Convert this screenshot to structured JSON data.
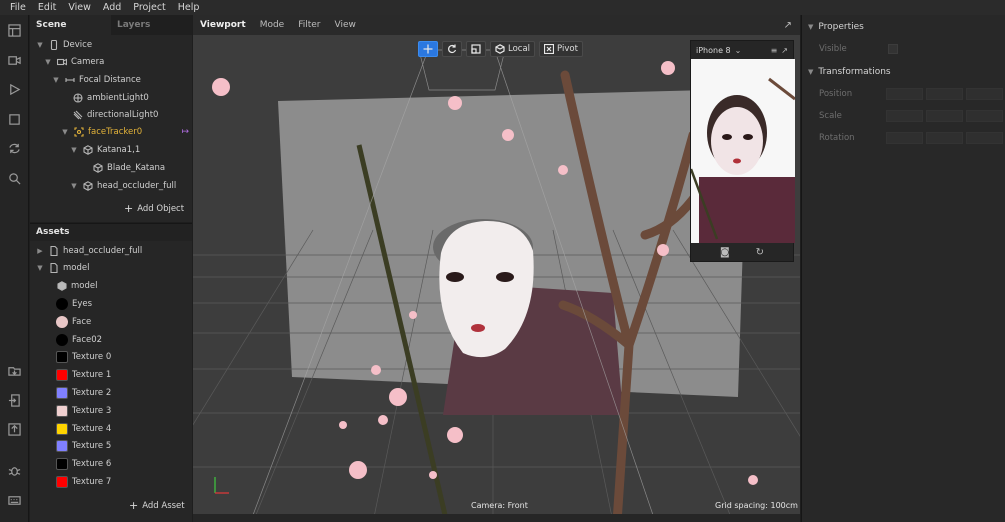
{
  "menu": [
    "File",
    "Edit",
    "View",
    "Add",
    "Project",
    "Help"
  ],
  "scene_panel": {
    "tabs": [
      "Scene",
      "Layers"
    ],
    "tree": [
      {
        "label": "Device",
        "icon": "device-icon",
        "depth": 0
      },
      {
        "label": "Camera",
        "icon": "camera-icon",
        "depth": 1
      },
      {
        "label": "Focal Distance",
        "icon": "focal-distance-icon",
        "depth": 2
      },
      {
        "label": "ambientLight0",
        "icon": "ambient-light-icon",
        "depth": 3
      },
      {
        "label": "directionalLight0",
        "icon": "directional-light-icon",
        "depth": 3
      },
      {
        "label": "faceTracker0",
        "icon": "face-tracker-icon",
        "depth": 3
      },
      {
        "label": "Katana1,1",
        "icon": "cube-icon",
        "depth": 4
      },
      {
        "label": "Blade_Katana",
        "icon": "cube-icon",
        "depth": 5
      },
      {
        "label": "head_occluder_full",
        "icon": "cube-icon",
        "depth": 4
      }
    ],
    "add_object_label": "Add Object"
  },
  "assets_panel": {
    "title": "Assets",
    "items": [
      {
        "label": "head_occluder_full",
        "depth": 0,
        "kind": "file",
        "color": ""
      },
      {
        "label": "model",
        "depth": 0,
        "kind": "file",
        "color": ""
      },
      {
        "label": "model",
        "depth": 1,
        "kind": "cube",
        "color": ""
      },
      {
        "label": "Eyes",
        "depth": 1,
        "kind": "sphere",
        "color": "#000000"
      },
      {
        "label": "Face",
        "depth": 1,
        "kind": "sphere",
        "color": "#e9c7c7"
      },
      {
        "label": "Face02",
        "depth": 1,
        "kind": "sphere",
        "color": "#000000"
      },
      {
        "label": "Texture 0",
        "depth": 1,
        "kind": "swatch",
        "color": "#000000"
      },
      {
        "label": "Texture 1",
        "depth": 1,
        "kind": "swatch",
        "color": "#ff0000"
      },
      {
        "label": "Texture 2",
        "depth": 1,
        "kind": "swatch",
        "color": "#8080ff"
      },
      {
        "label": "Texture 3",
        "depth": 1,
        "kind": "swatch",
        "color": "#f0d0d0"
      },
      {
        "label": "Texture 4",
        "depth": 1,
        "kind": "swatch",
        "color": "#ffd400"
      },
      {
        "label": "Texture 5",
        "depth": 1,
        "kind": "swatch",
        "color": "#8080ff"
      },
      {
        "label": "Texture 6",
        "depth": 1,
        "kind": "swatch",
        "color": "#000000"
      },
      {
        "label": "Texture 7",
        "depth": 1,
        "kind": "swatch",
        "color": "#ff0000"
      }
    ],
    "add_asset_label": "Add Asset"
  },
  "viewport": {
    "tabs": [
      "Viewport",
      "Mode",
      "Filter",
      "View"
    ],
    "local_label": "Local",
    "pivot_label": "Pivot",
    "camera_label": "Camera: Front",
    "grid_label": "Grid spacing: 100cm"
  },
  "preview": {
    "device": "iPhone 8"
  },
  "properties": {
    "title": "Properties",
    "visible_label": "Visible",
    "transformations_title": "Transformations",
    "rows": [
      "Position",
      "Scale",
      "Rotation"
    ]
  }
}
